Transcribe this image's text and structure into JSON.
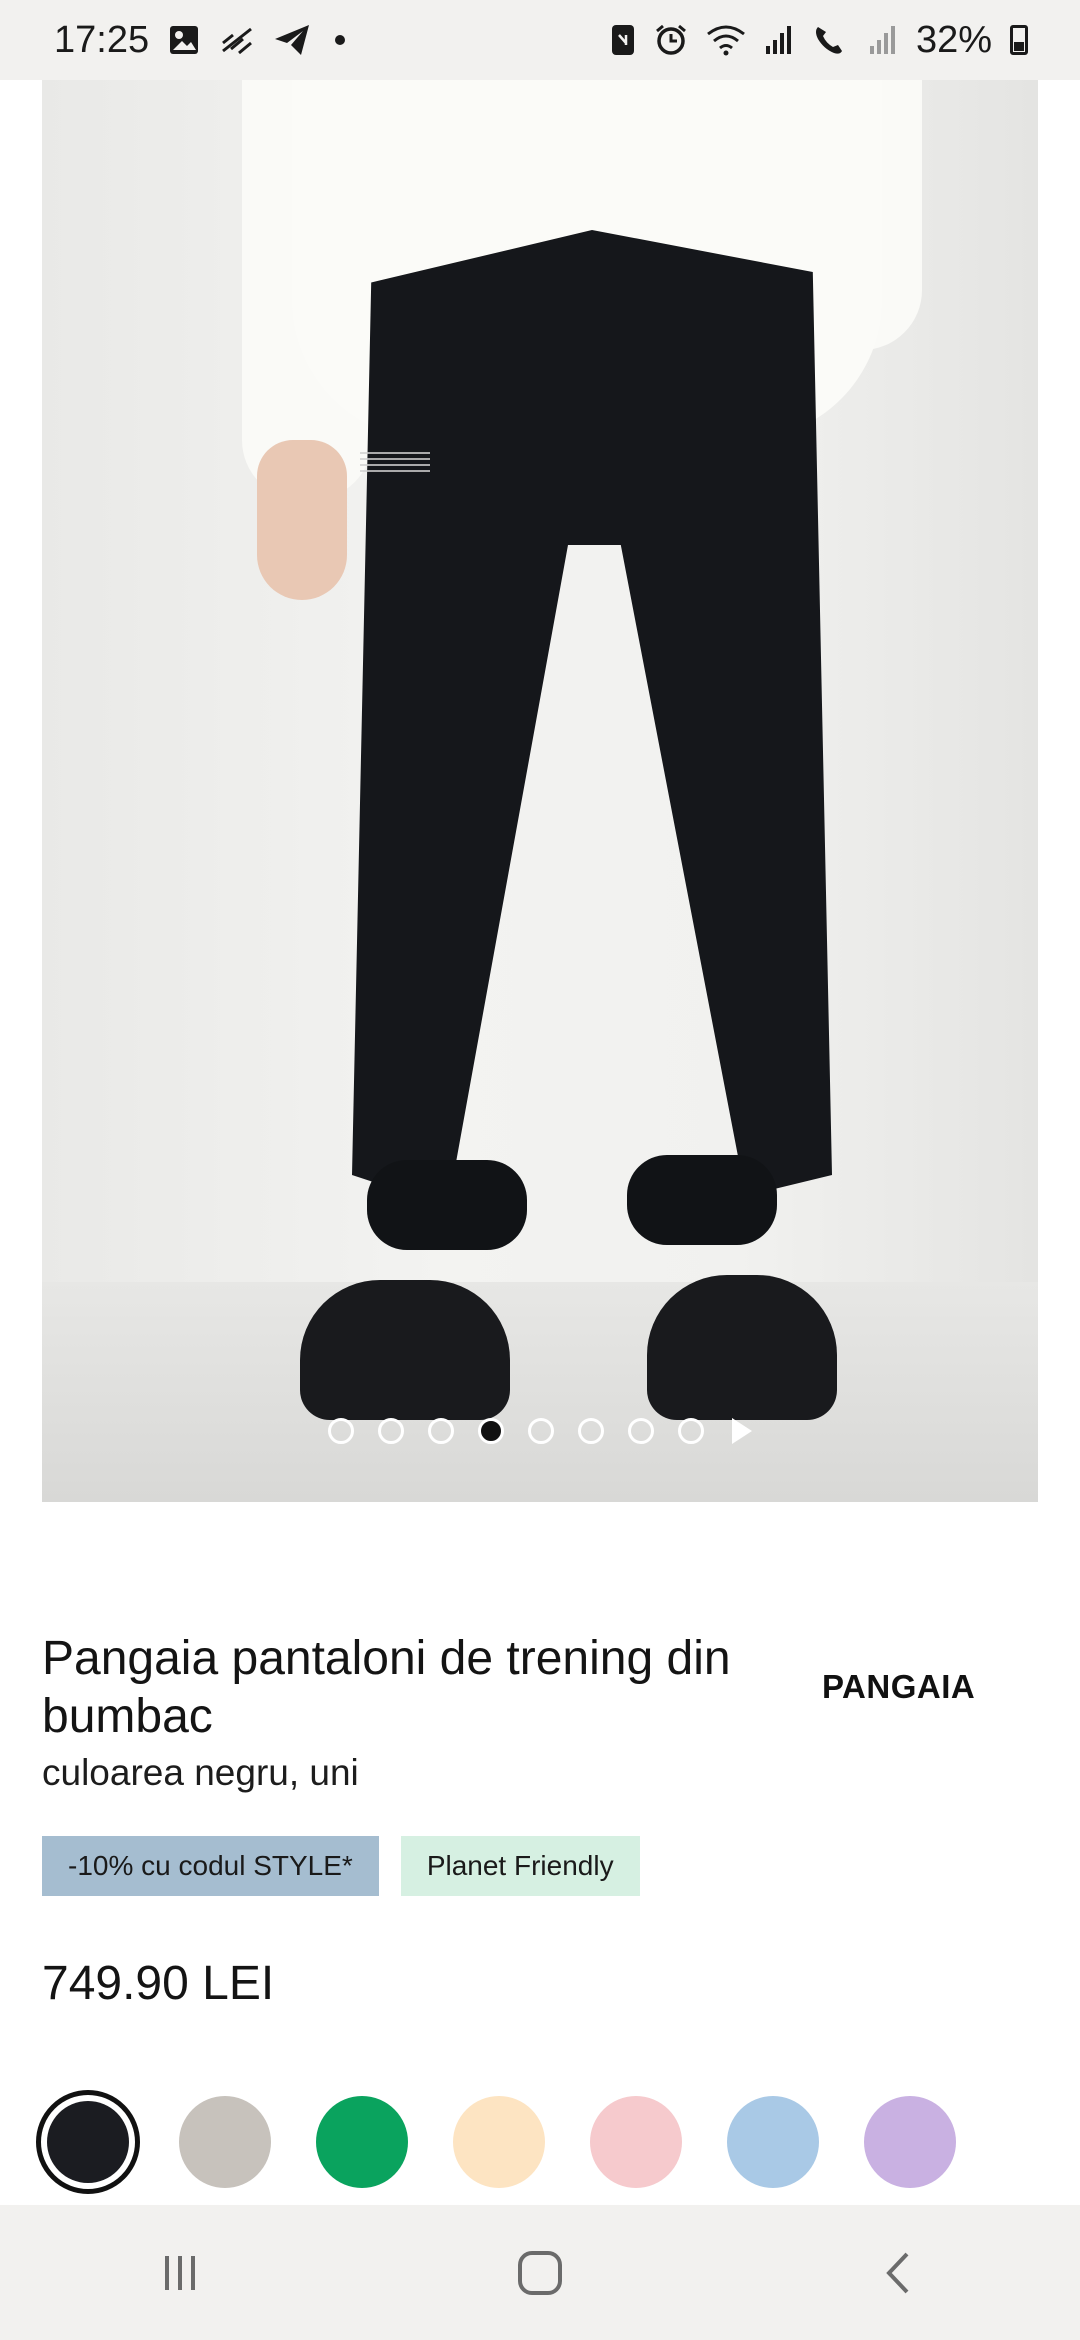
{
  "status_bar": {
    "time": "17:25",
    "battery": "32%",
    "left_icons": [
      "gallery-icon",
      "signal-slash-icon",
      "telegram-icon",
      "dot-icon"
    ],
    "right_icons": [
      "nfc-icon",
      "alarm-icon",
      "wifi-icon",
      "signal-icon",
      "call-icon",
      "signal-icon-2",
      "battery-icon"
    ]
  },
  "product_image": {
    "carousel": {
      "total_dots": 8,
      "active_index": 3
    }
  },
  "product": {
    "title": "Pangaia pantaloni de trening din bumbac",
    "subtitle": "culoarea negru, uni",
    "brand": "PANGAIA",
    "tags": [
      {
        "label": "-10% cu codul STYLE*",
        "color": "#a5bdd0"
      },
      {
        "label": "Planet Friendly",
        "color": "#d6f0e2"
      }
    ],
    "price": "749.90 LEI"
  },
  "swatches": [
    {
      "name": "black",
      "color": "#1b1c21",
      "selected": true
    },
    {
      "name": "grey",
      "color": "#c7c2bc",
      "selected": false
    },
    {
      "name": "green",
      "color": "#0aa35e",
      "selected": false
    },
    {
      "name": "cream",
      "color": "#fde4c2",
      "selected": false
    },
    {
      "name": "pink",
      "color": "#f6cacd",
      "selected": false
    },
    {
      "name": "blue",
      "color": "#a9c9e6",
      "selected": false
    },
    {
      "name": "lavender",
      "color": "#c9b1e2",
      "selected": false
    }
  ],
  "nav_bar": {
    "buttons": [
      "recent-apps-icon",
      "home-icon",
      "back-icon"
    ]
  }
}
